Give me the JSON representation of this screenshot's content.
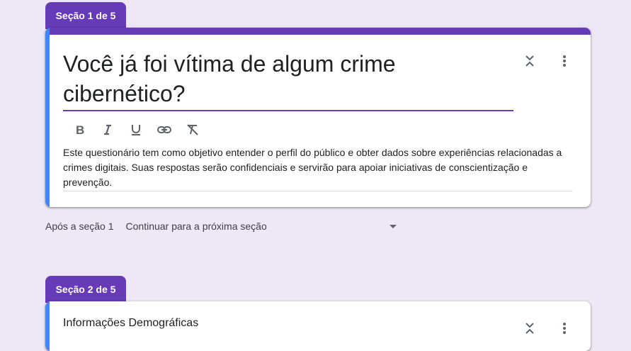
{
  "section1": {
    "tab_label": "Seção 1 de 5",
    "title": "Você já foi vítima de algum crime cibernético?",
    "description": " Este questionário tem como objetivo entender o perfil do público e obter dados sobre experiências relacionadas a crimes digitais. Suas respostas serão confidenciais e servirão para apoiar iniciativas de conscientização e prevenção.",
    "toolbar": [
      "bold-icon",
      "italic-icon",
      "underline-icon",
      "link-icon",
      "clear-format-icon"
    ]
  },
  "after_section": {
    "label": "Após a seção 1",
    "selected": "Continuar para a próxima seção"
  },
  "section2": {
    "tab_label": "Seção 2 de 5",
    "title": "Informações Demográficas"
  },
  "colors": {
    "accent": "#673ab7",
    "focus_bar": "#4285f4",
    "background": "#ede7f6"
  }
}
